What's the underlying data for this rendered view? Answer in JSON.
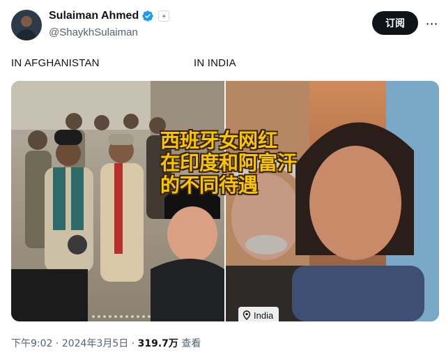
{
  "author": {
    "display_name": "Sulaiman Ahmed",
    "handle": "@ShaykhSulaiman",
    "avatar_icon": "user-avatar-icon",
    "verified_icon": "verified-badge-icon",
    "badge_icon": "affiliate-badge-icon",
    "badge_text": "☀"
  },
  "actions": {
    "subscribe_label": "订阅",
    "more_icon": "more-dots-icon",
    "more_glyph": "⋯"
  },
  "media": {
    "left_label": "IN AFGHANISTAN",
    "right_label": "IN INDIA",
    "caption_lines": [
      "西班牙女网红",
      "在印度和阿富汗",
      "的不同待遇"
    ],
    "location_tag": "India",
    "location_icon": "location-pin-icon"
  },
  "meta": {
    "time": "下午9:02",
    "separator": " · ",
    "date": "2024年3月5日",
    "views_count": "319.7万",
    "views_label": "查看"
  },
  "colors": {
    "caption_fill": "#f7c600",
    "caption_outline": "#3a2300",
    "verified_blue": "#1d9bf0",
    "button_bg": "#0f1419",
    "muted_text": "#536471"
  }
}
